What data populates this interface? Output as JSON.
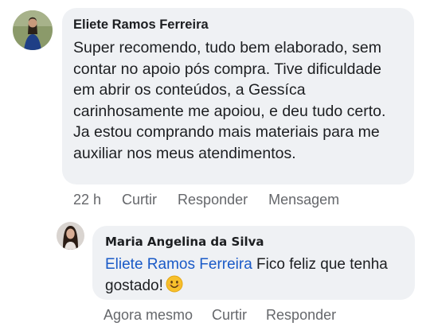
{
  "comment": {
    "author": "Eliete Ramos Ferreira",
    "text": "Super recomendo, tudo bem elaborado, sem contar no apoio pós compra. Tive dificuldade em abrir os conteúdos, a Gessíca carinhosamente me apoiou, e deu tudo certo. Ja estou comprando mais materiais para me auxiliar nos meus atendimentos.",
    "time": "22 h",
    "actions": {
      "like": "Curtir",
      "reply": "Responder",
      "message": "Mensagem"
    }
  },
  "reply": {
    "author": "Maria Angelina da Silva",
    "mention": "Eliete Ramos Ferreira",
    "text": " Fico feliz que tenha gostado!",
    "emoji": "smiling-face-emoji",
    "time": "Agora mesmo",
    "actions": {
      "like": "Curtir",
      "reply": "Responder"
    }
  },
  "colors": {
    "bubble": "#eff1f4",
    "secondary_text": "#65676b",
    "mention": "#1a5ac7"
  }
}
